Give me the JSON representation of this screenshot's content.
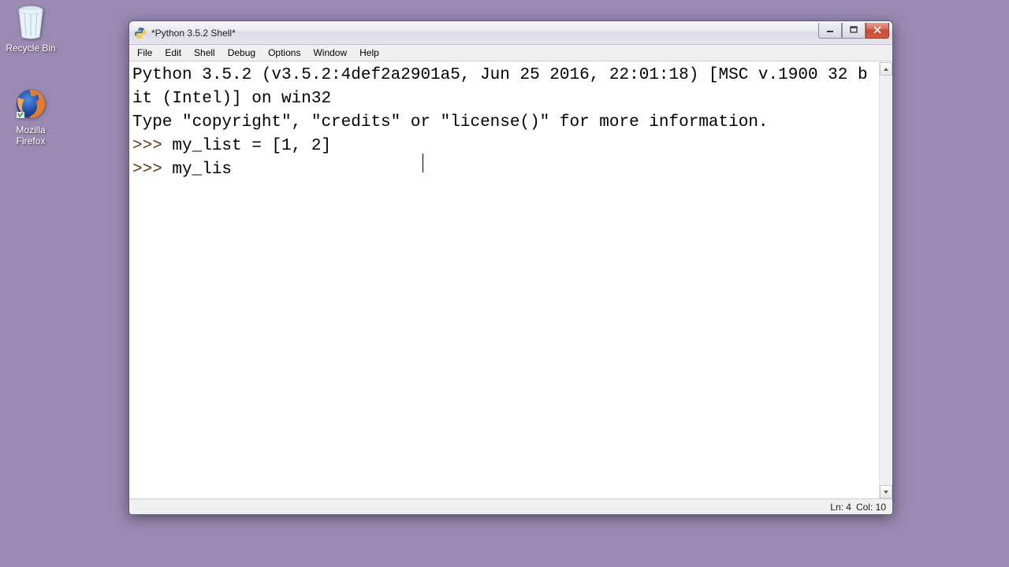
{
  "desktop": {
    "recycle_bin": {
      "label": "Recycle Bin"
    },
    "firefox": {
      "label": "Mozilla\nFirefox"
    }
  },
  "window": {
    "title": "*Python 3.5.2 Shell*",
    "menu": {
      "file": "File",
      "edit": "Edit",
      "shell": "Shell",
      "debug": "Debug",
      "options": "Options",
      "window": "Window",
      "help": "Help"
    },
    "shell": {
      "banner_line1": "Python 3.5.2 (v3.5.2:4def2a2901a5, Jun 25 2016, 22:01:18) [MSC v.1900 32 bit (Intel)] on win32",
      "banner_line2": "Type \"copyright\", \"credits\" or \"license()\" for more information.",
      "prompt": ">>> ",
      "line1_code": "my_list = [1, 2]",
      "line2_code": "my_lis"
    },
    "statusbar": {
      "line": "Ln: 4",
      "col": "Col: 10"
    }
  }
}
